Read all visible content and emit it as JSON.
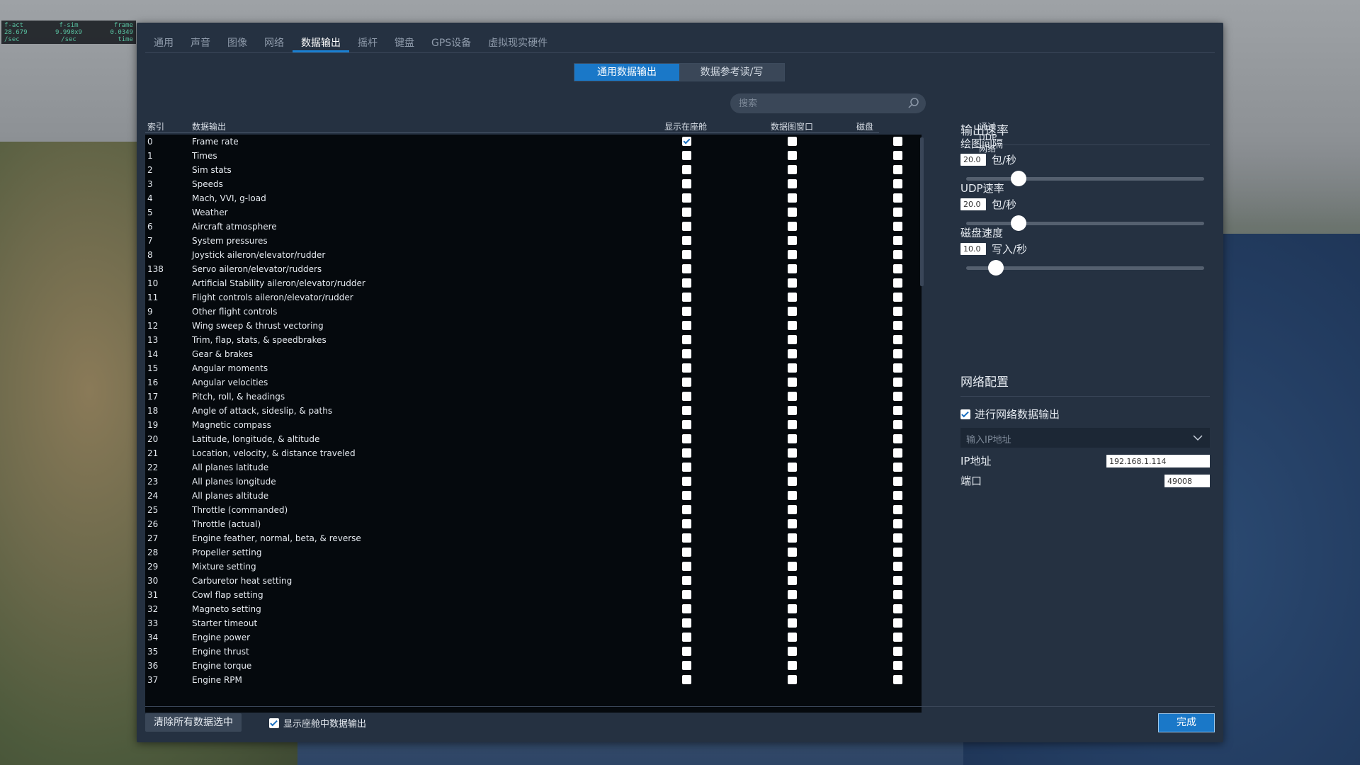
{
  "overlay": {
    "labels": [
      "f-act",
      "f-sim",
      "frame"
    ],
    "values": [
      "28.679",
      "9.990x9",
      "0.0349"
    ],
    "units": [
      "/sec",
      "/sec",
      "time"
    ]
  },
  "tabs": [
    "通用",
    "声音",
    "图像",
    "网络",
    "数据输出",
    "摇杆",
    "键盘",
    "GPS设备",
    "虚拟现实硬件"
  ],
  "active_tab": 4,
  "segments": [
    "通用数据输出",
    "数据参考读/写"
  ],
  "search": {
    "placeholder": "搜索"
  },
  "table": {
    "headers": {
      "index": "索引",
      "name": "数据输出",
      "cockpit": "显示在座舱",
      "graph": "数据图窗口",
      "disk": "磁盘（data.txt 文件）",
      "udp": "通过UDP网络"
    },
    "rows": [
      {
        "idx": "0",
        "name": "Frame rate",
        "cockpit": true,
        "graph": false,
        "disk": false,
        "udp": false
      },
      {
        "idx": "1",
        "name": "Times",
        "cockpit": false,
        "graph": false,
        "disk": false,
        "udp": false
      },
      {
        "idx": "2",
        "name": "Sim stats",
        "cockpit": false,
        "graph": false,
        "disk": false,
        "udp": false
      },
      {
        "idx": "3",
        "name": "Speeds",
        "cockpit": false,
        "graph": false,
        "disk": false,
        "udp": true
      },
      {
        "idx": "4",
        "name": "Mach, VVI, g-load",
        "cockpit": false,
        "graph": false,
        "disk": false,
        "udp": true
      },
      {
        "idx": "5",
        "name": "Weather",
        "cockpit": false,
        "graph": false,
        "disk": false,
        "udp": false
      },
      {
        "idx": "6",
        "name": "Aircraft atmosphere",
        "cockpit": false,
        "graph": false,
        "disk": false,
        "udp": false
      },
      {
        "idx": "7",
        "name": "System pressures",
        "cockpit": false,
        "graph": false,
        "disk": false,
        "udp": false
      },
      {
        "idx": "8",
        "name": "Joystick aileron/elevator/rudder",
        "cockpit": false,
        "graph": false,
        "disk": false,
        "udp": false
      },
      {
        "idx": "138",
        "name": "Servo aileron/elevator/rudders",
        "cockpit": false,
        "graph": false,
        "disk": false,
        "udp": false
      },
      {
        "idx": "10",
        "name": "Artificial Stability aileron/elevator/rudder",
        "cockpit": false,
        "graph": false,
        "disk": false,
        "udp": false
      },
      {
        "idx": "11",
        "name": "Flight controls aileron/elevator/rudder",
        "cockpit": false,
        "graph": false,
        "disk": false,
        "udp": false
      },
      {
        "idx": "9",
        "name": "Other flight controls",
        "cockpit": false,
        "graph": false,
        "disk": false,
        "udp": false
      },
      {
        "idx": "12",
        "name": "Wing sweep & thrust vectoring",
        "cockpit": false,
        "graph": false,
        "disk": false,
        "udp": false
      },
      {
        "idx": "13",
        "name": "Trim, flap, stats, & speedbrakes",
        "cockpit": false,
        "graph": false,
        "disk": false,
        "udp": false
      },
      {
        "idx": "14",
        "name": "Gear & brakes",
        "cockpit": false,
        "graph": false,
        "disk": false,
        "udp": false
      },
      {
        "idx": "15",
        "name": "Angular moments",
        "cockpit": false,
        "graph": false,
        "disk": false,
        "udp": false
      },
      {
        "idx": "16",
        "name": "Angular velocities",
        "cockpit": false,
        "graph": false,
        "disk": false,
        "udp": false
      },
      {
        "idx": "17",
        "name": "Pitch, roll, & headings",
        "cockpit": false,
        "graph": false,
        "disk": false,
        "udp": true
      },
      {
        "idx": "18",
        "name": "Angle of attack, sideslip, & paths",
        "cockpit": false,
        "graph": false,
        "disk": false,
        "udp": false
      },
      {
        "idx": "19",
        "name": "Magnetic compass",
        "cockpit": false,
        "graph": false,
        "disk": false,
        "udp": false
      },
      {
        "idx": "20",
        "name": "Latitude, longitude, & altitude",
        "cockpit": false,
        "graph": false,
        "disk": false,
        "udp": true
      },
      {
        "idx": "21",
        "name": "Location, velocity, & distance traveled",
        "cockpit": false,
        "graph": false,
        "disk": false,
        "udp": true
      },
      {
        "idx": "22",
        "name": "All planes latitude",
        "cockpit": false,
        "graph": false,
        "disk": false,
        "udp": false
      },
      {
        "idx": "23",
        "name": "All planes longitude",
        "cockpit": false,
        "graph": false,
        "disk": false,
        "udp": false
      },
      {
        "idx": "24",
        "name": "All planes altitude",
        "cockpit": false,
        "graph": false,
        "disk": false,
        "udp": false
      },
      {
        "idx": "25",
        "name": "Throttle (commanded)",
        "cockpit": false,
        "graph": false,
        "disk": false,
        "udp": false
      },
      {
        "idx": "26",
        "name": "Throttle (actual)",
        "cockpit": false,
        "graph": false,
        "disk": false,
        "udp": false
      },
      {
        "idx": "27",
        "name": "Engine feather, normal, beta, & reverse",
        "cockpit": false,
        "graph": false,
        "disk": false,
        "udp": false
      },
      {
        "idx": "28",
        "name": "Propeller setting",
        "cockpit": false,
        "graph": false,
        "disk": false,
        "udp": false
      },
      {
        "idx": "29",
        "name": "Mixture setting",
        "cockpit": false,
        "graph": false,
        "disk": false,
        "udp": false
      },
      {
        "idx": "30",
        "name": "Carburetor heat setting",
        "cockpit": false,
        "graph": false,
        "disk": false,
        "udp": false
      },
      {
        "idx": "31",
        "name": "Cowl flap setting",
        "cockpit": false,
        "graph": false,
        "disk": false,
        "udp": false
      },
      {
        "idx": "32",
        "name": "Magneto setting",
        "cockpit": false,
        "graph": false,
        "disk": false,
        "udp": false
      },
      {
        "idx": "33",
        "name": "Starter timeout",
        "cockpit": false,
        "graph": false,
        "disk": false,
        "udp": false
      },
      {
        "idx": "34",
        "name": "Engine power",
        "cockpit": false,
        "graph": false,
        "disk": false,
        "udp": false
      },
      {
        "idx": "35",
        "name": "Engine thrust",
        "cockpit": false,
        "graph": false,
        "disk": false,
        "udp": false
      },
      {
        "idx": "36",
        "name": "Engine torque",
        "cockpit": false,
        "graph": false,
        "disk": false,
        "udp": false
      },
      {
        "idx": "37",
        "name": "Engine RPM",
        "cockpit": false,
        "graph": false,
        "disk": false,
        "udp": false
      }
    ]
  },
  "rates": {
    "title": "输出速率",
    "items": [
      {
        "label": "绘图间隔",
        "value": "20.0",
        "unit": "包/秒",
        "level": 0.2
      },
      {
        "label": "UDP速率",
        "value": "20.0",
        "unit": "包/秒",
        "level": 0.2
      },
      {
        "label": "磁盘速度",
        "value": "10.0",
        "unit": "写入/秒",
        "level": 0.1
      }
    ]
  },
  "network": {
    "title": "网络配置",
    "enable_label": "进行网络数据输出",
    "enabled": true,
    "ip_select_placeholder": "输入IP地址",
    "ip_label": "IP地址",
    "ip_value": "192.168.1.114",
    "port_label": "端口",
    "port_value": "49008"
  },
  "footer": {
    "clear_label": "清除所有数据选中",
    "show_cockpit_label": "显示座舱中数据输出",
    "show_cockpit_checked": true,
    "done_label": "完成"
  },
  "colors": {
    "accent": "#1a78c8",
    "dialog_bg": "#253141",
    "table_bg": "#05090d"
  }
}
